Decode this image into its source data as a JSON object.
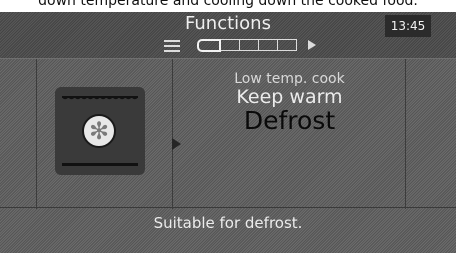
{
  "caption": "down temperature and cooling down the cooked food.",
  "header": {
    "title": "Functions",
    "clock": "13:45"
  },
  "pager": {
    "pages": 5,
    "current": 1
  },
  "function_icon": "fan-heater-icon",
  "options": [
    "Low temp. cook",
    "Keep warm",
    "Defrost"
  ],
  "selected_option": "Defrost",
  "footer": {
    "description": "Suitable for defrost."
  },
  "colors": {
    "panel": "#5d5d5d",
    "header": "#4a4a4a",
    "clock_bg": "#2b2b2b",
    "selected_text": "#0a0a0a"
  }
}
